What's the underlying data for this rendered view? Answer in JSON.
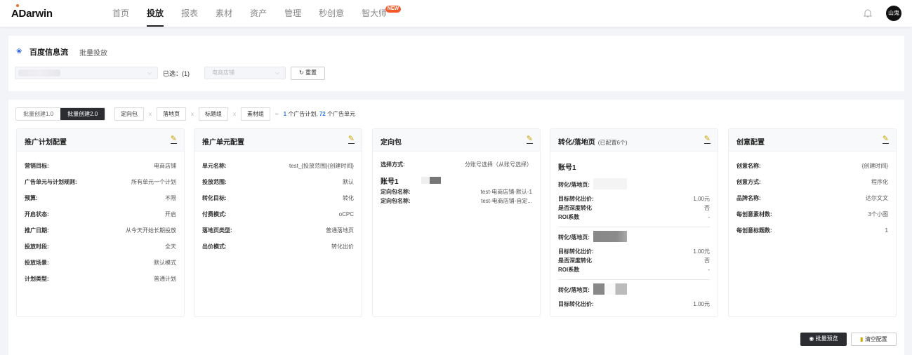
{
  "header": {
    "logo": "ADarwin",
    "nav": [
      "首页",
      "投放",
      "报表",
      "素材",
      "资产",
      "管理",
      "秒创意",
      "智大师"
    ],
    "active": "投放",
    "new_badge": "NEW",
    "avatar": "山鬼"
  },
  "filters": {
    "platform": "百度信息流",
    "mode": "批量投放",
    "selected": "已选：(1)",
    "marketing_placeholder": "电商店铺",
    "reset": "重置"
  },
  "toolbar": {
    "tabs": [
      "批量创建1.0",
      "批量创建2.0"
    ],
    "active_tab": "批量创建2.0",
    "chips": [
      "定向包",
      "落地页",
      "标题组",
      "素材组"
    ],
    "times": "x",
    "equals": "=",
    "plan_count": "1",
    "plan_text": "个广告计划,",
    "unit_count": "72",
    "unit_text": "个广告单元"
  },
  "cards": {
    "plan": {
      "title": "推广计划配置",
      "rows": [
        [
          "营销目标:",
          "电商店铺"
        ],
        [
          "广告单元与计划规则:",
          "所有单元一个计划"
        ],
        [
          "预算:",
          "不限"
        ],
        [
          "开启状态:",
          "开启"
        ],
        [
          "推广日期:",
          "从今天开始长期投放"
        ],
        [
          "投放时段:",
          "全天"
        ],
        [
          "投放场景:",
          "默认模式"
        ],
        [
          "计划类型:",
          "普通计划"
        ]
      ]
    },
    "unit": {
      "title": "推广单元配置",
      "rows": [
        [
          "单元名称:",
          "test_{投放范围}{创建时间}"
        ],
        [
          "投放范围:",
          "默认"
        ],
        [
          "转化目标:",
          "转化"
        ],
        [
          "付费模式:",
          "oCPC"
        ],
        [
          "落地页类型:",
          "普通落地页"
        ],
        [
          "出价模式:",
          "转化出价"
        ]
      ]
    },
    "targeting": {
      "title": "定向包",
      "select_label": "选择方式:",
      "select_value": "分账号选择（从账号选择）",
      "account": "账号1",
      "rows": [
        [
          "定向包名称:",
          "test-电商店铺-默认-1"
        ],
        [
          "定向包名称:",
          "test-电商店铺-自定..."
        ]
      ]
    },
    "landing": {
      "title": "转化/落地页",
      "subtitle": "(已配置6个)",
      "account": "账号1",
      "page_label": "转化/落地页:",
      "bid_label": "目标转化出价:",
      "bid": "1.00元",
      "deep_label": "是否深度转化",
      "deep": "否",
      "roi_label": "ROI系数",
      "roi": "-"
    },
    "creative": {
      "title": "创意配置",
      "rows": [
        [
          "创意名称:",
          "{创建时间}"
        ],
        [
          "创意方式:",
          "程序化"
        ],
        [
          "品牌名称:",
          "达尔文文"
        ],
        [
          "每创意素材数:",
          "3个小图"
        ],
        [
          "每创意标题数:",
          "1"
        ]
      ]
    }
  },
  "footer": {
    "preview": "批量预览",
    "clear": "清空配置"
  }
}
